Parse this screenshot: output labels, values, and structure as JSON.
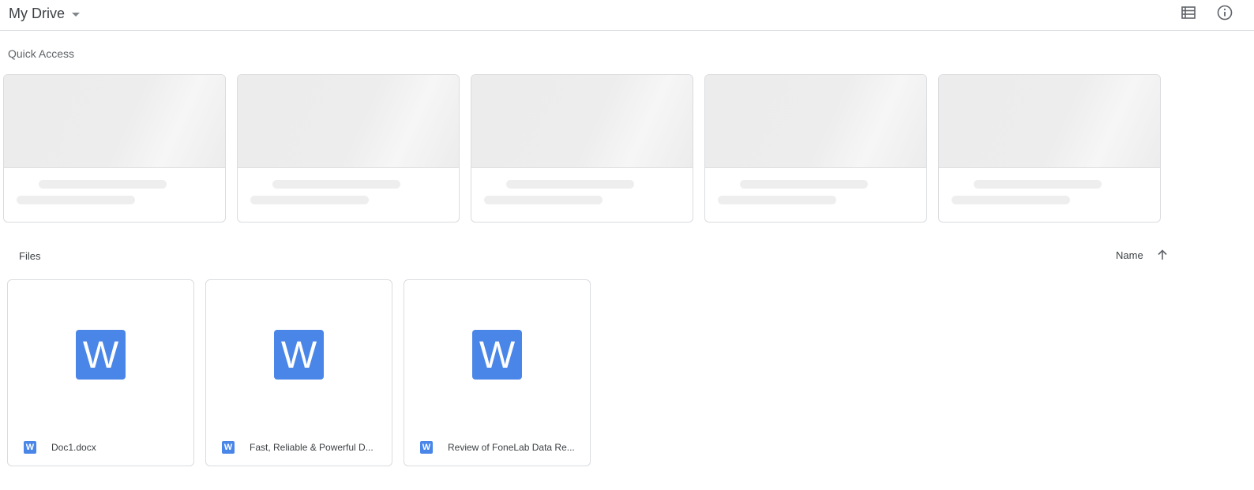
{
  "header": {
    "title": "My Drive",
    "caret_icon": "arrow-drop-down-icon",
    "list_view_icon": "list-view-icon",
    "info_icon": "info-icon"
  },
  "quick_access": {
    "label": "Quick Access",
    "cards": [
      {},
      {},
      {},
      {},
      {}
    ]
  },
  "files": {
    "label": "Files",
    "sort": {
      "label": "Name",
      "direction_icon": "arrow-upward-icon"
    },
    "items": [
      {
        "name": "Doc1.docx",
        "type_letter": "W"
      },
      {
        "name": "Fast, Reliable & Powerful D...",
        "type_letter": "W"
      },
      {
        "name": "Review of FoneLab Data Re...",
        "type_letter": "W"
      }
    ]
  },
  "colors": {
    "word_blue": "#4a86e8",
    "border": "#dadce0",
    "skeleton": "#eeeeee"
  }
}
